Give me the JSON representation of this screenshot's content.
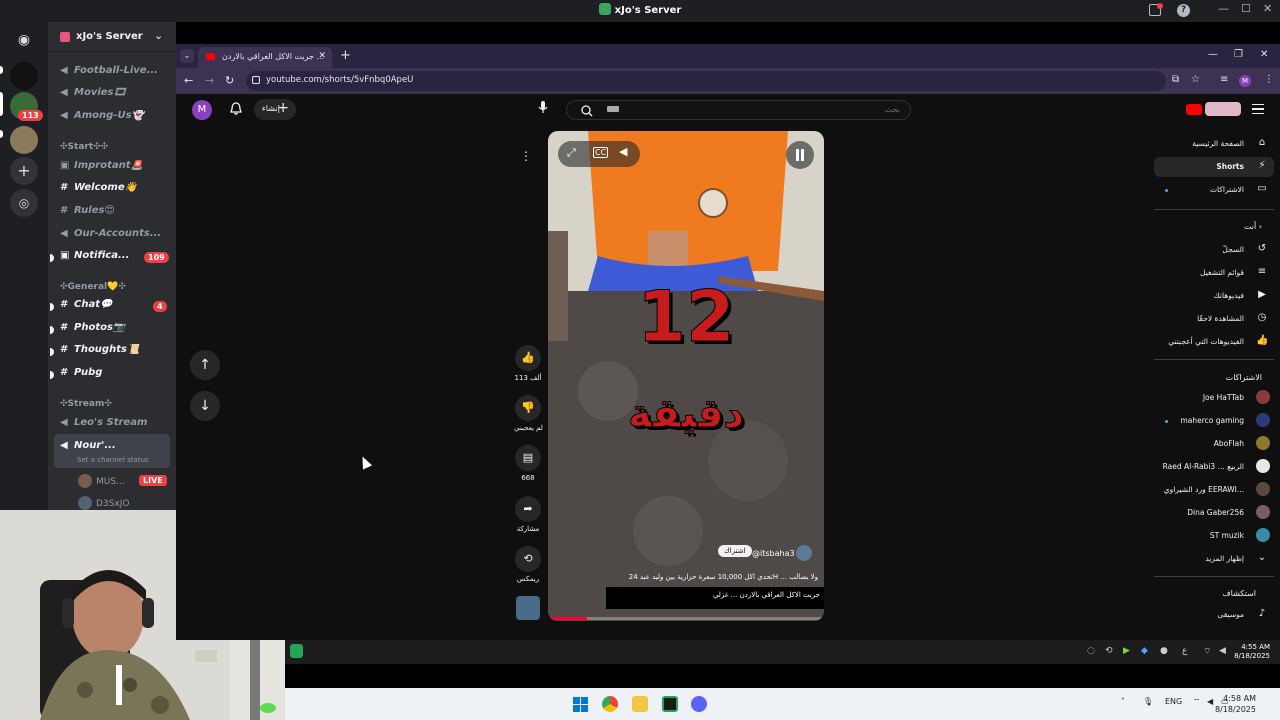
{
  "discord": {
    "window_title": "xJo's Server",
    "server_name": "xJo's Server",
    "mention_count": "113",
    "channels": [
      {
        "label": "Football-Live...",
        "icon": "speaker-icon",
        "unread": false
      },
      {
        "label": "Movies🎞",
        "icon": "speaker-icon",
        "unread": false
      },
      {
        "label": "Among-Us👻",
        "icon": "speaker-icon",
        "unread": false
      },
      {
        "label": "Improtant🚨",
        "icon": "announcement-icon",
        "unread": false
      },
      {
        "label": "Welcome👋",
        "icon": "hash-icon",
        "unread": true
      },
      {
        "label": "Rules😍",
        "icon": "hash-icon",
        "unread": false
      },
      {
        "label": "Our-Accounts...",
        "icon": "hash-icon",
        "unread": false
      },
      {
        "label": "Notifica...",
        "icon": "announcement-icon",
        "unread": true,
        "badge": "109"
      },
      {
        "label": "Chat💬",
        "icon": "hash-icon",
        "unread": true,
        "badge": "4"
      },
      {
        "label": "Photos📷",
        "icon": "hash-icon",
        "unread": true
      },
      {
        "label": "Thoughts📜",
        "icon": "hash-icon",
        "unread": true
      },
      {
        "label": "Pubg",
        "icon": "hash-icon",
        "unread": true
      },
      {
        "label": "Leo's Stream",
        "icon": "speaker-icon",
        "unread": false
      },
      {
        "label": "Nour'...",
        "icon": "speaker-icon",
        "unread": true
      }
    ],
    "categories": {
      "start": "✣Start✣✣",
      "general": "✣General💛✣",
      "stream": "✣Stream✣"
    },
    "channel_status": "Set a channel status",
    "voice_users": [
      {
        "name": "MUS...",
        "live": "LIVE"
      },
      {
        "name": "D3SxJO"
      }
    ]
  },
  "browser": {
    "tab_title": "جربت الاكل العراقي بالاردن ...",
    "url": "youtube.com/shorts/5vFnbq0ApeU"
  },
  "youtube": {
    "search_placeholder": "بحث",
    "avatar_letter": "M",
    "create_label": "إنشاء",
    "video": {
      "overlay_number": "12",
      "overlay_word": "دقيقة",
      "channel_handle": "@itsbaha3",
      "subscribe_label": "اشتراك",
      "music_line": "تحدي اكل 10,000 سعرة حرارية بين وليد عبد 24H ... ولا يصالب",
      "caption": "جربت الاكل العراقي بالاردن ... غزلي",
      "progress": 0.14
    },
    "actions": {
      "likes": "113 ألف",
      "dislike_label": "لم يعجبني",
      "comments": "668",
      "share_label": "مشاركة",
      "remix_label": "ريمكس"
    },
    "sidebar": {
      "home": "الصفحة الرئيسية",
      "shorts": "Shorts",
      "subscriptions": "الاشتراكات",
      "you": "أنت",
      "history": "السجلّ",
      "playlists": "قوائم التشغيل",
      "your_videos": "فيديوهاتك",
      "watch_later": "المشاهدة لاحقًا",
      "liked": "الفيديوهات التي أعجبتني",
      "subs_header": "الاشتراكات",
      "subs": [
        "Joe HaTTab",
        "maherco gaming",
        "AboFlah",
        "Raed Al-Rabi3 ... الربيع",
        "ورد الشيراوي EERAWI...",
        "Dina Gaber256",
        "ST muzik"
      ],
      "show_more": "إظهار المزيد",
      "explore": "استكشاف",
      "music": "موسيقى"
    }
  },
  "inner_clock": {
    "time": "4:55 AM",
    "date": "8/18/2025"
  },
  "taskbar": {
    "lang": "ENG",
    "time": "4:58 AM",
    "date": "8/18/2025"
  }
}
